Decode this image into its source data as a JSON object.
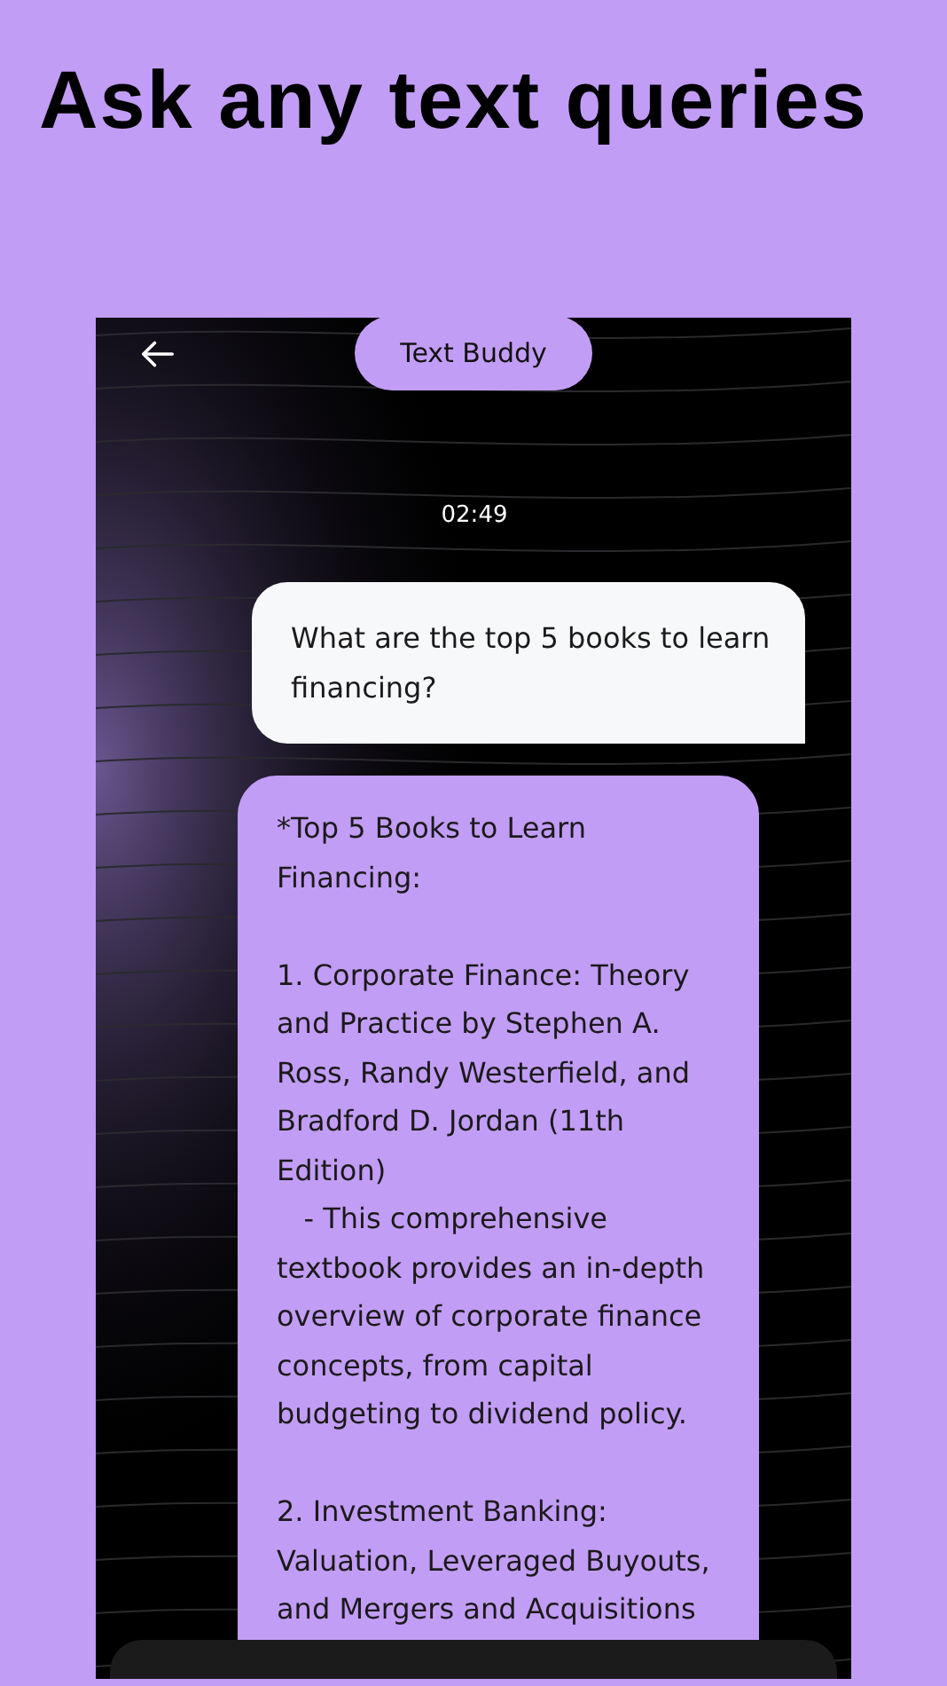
{
  "headline": "Ask any text queries",
  "screen": {
    "title": "Text Buddy",
    "time": "02:49",
    "messages": [
      {
        "kind": "user",
        "text": "What are the top 5 books to learn\nfinancing?"
      },
      {
        "kind": "bot",
        "text": "*Top 5 Books to Learn\nFinancing:\n\n1. Corporate Finance: Theory\nand Practice by Stephen A.\nRoss, Randy Westerfield, and\nBradford D. Jordan (11th\nEdition)\n   - This comprehensive\ntextbook provides an in-depth\noverview of corporate finance\nconcepts, from capital\nbudgeting to dividend policy.\n\n2. Investment Banking:\nValuation, Leveraged Buyouts,\nand Mergers and Acquisitions"
      }
    ]
  }
}
